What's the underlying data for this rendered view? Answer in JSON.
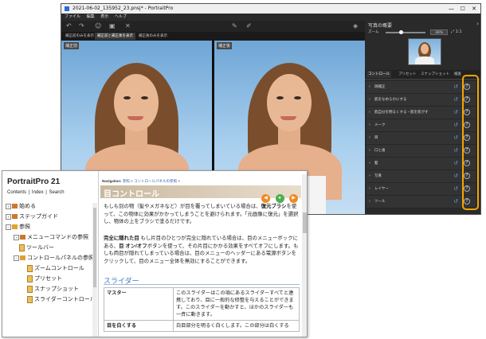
{
  "app_window": {
    "title": "2021-06-02_135952_23.pnsj* - PortraitPro",
    "controls": [
      "—",
      "☐",
      "✕"
    ],
    "menu": [
      "ファイル",
      "編集",
      "表示",
      "ヘルプ"
    ],
    "view_tabs": [
      "補正前のみを表示",
      "補正前と補正後を表示",
      "補正後のみを表示"
    ],
    "active_view_tab": 1,
    "photo_label_left": "補正前",
    "photo_label_right": "補正後",
    "right_panel": {
      "title": "写真の概要",
      "zoom_label": "ズーム",
      "zoom_value": "38%",
      "zoom_level": 0.38,
      "tabs": [
        "コントロール",
        "プリセット",
        "スナップショット",
        "検査"
      ],
      "active_tab": 0,
      "sections": [
        "顔補正",
        "肌をなめらかにする",
        "肌自分を明るくする・肌を焦がす",
        "メーク",
        "目",
        "口と歯",
        "髪",
        "写真",
        "レイヤー",
        "ツール"
      ]
    }
  },
  "help_window": {
    "app_name": "PortraitPro 21",
    "nav_links": [
      "Contents",
      "|",
      "Index",
      "|",
      "Search"
    ],
    "tree": [
      {
        "label": "始める",
        "indent": 0,
        "kind": "book-closed",
        "toggle": "+"
      },
      {
        "label": "ステップガイド",
        "indent": 0,
        "kind": "book-closed",
        "toggle": "+"
      },
      {
        "label": "参照",
        "indent": 0,
        "kind": "book-open",
        "toggle": "−"
      },
      {
        "label": "メニューコマンドの参照",
        "indent": 1,
        "kind": "book-closed",
        "toggle": "+"
      },
      {
        "label": "ツールバー",
        "indent": 1,
        "kind": "page",
        "toggle": ""
      },
      {
        "label": "コントロールパネルの参照",
        "indent": 1,
        "kind": "book-open",
        "toggle": "−"
      },
      {
        "label": "ズームコントロール",
        "indent": 2,
        "kind": "page",
        "toggle": ""
      },
      {
        "label": "プリセット",
        "indent": 2,
        "kind": "page",
        "toggle": ""
      },
      {
        "label": "スナップショット",
        "indent": 2,
        "kind": "page",
        "toggle": ""
      },
      {
        "label": "スライダーコントロール",
        "indent": 2,
        "kind": "page",
        "toggle": ""
      }
    ],
    "breadcrumb": {
      "prefix": "Navigation:",
      "items": [
        "参照",
        ">",
        "コントロールパネルの参照",
        ">"
      ]
    },
    "page_title": "目コントロール",
    "para1": {
      "pre": "もしも別の物（髪やメガネなど）が目を覆ってしまいている場合は、",
      "bold": "復元ブラシ",
      "post": "を使って、この物体に効果がかかってしまうことを避けられます。「元画像に復元」を選択し、物体の上をブラシで塗るだけです。"
    },
    "para2": {
      "bold1": "完全に隠れた目",
      "mid1": " もし片目のひとつが完全に隠れている場合は、目のメニューボックにある、",
      "bold2": "目 オン/オフ",
      "rest": "ボタンを使って、その片目にかかる効果をすべてオフにします。もしも両目が隠れてしまっている場合は、目のメニューのヘッダーにある電源ボタンをクリックして、目のメニュー全体を無効にすることができます。"
    },
    "section_title": "スライダー",
    "table": [
      {
        "key": "マスター",
        "value": "このスライダーはこの項にあるスライダーすべてと連携しており、目に一般的な修整を与えることができます。このスライダーを動かすと、ほかのスライダーも一斉に動きます。"
      },
      {
        "key": "目を白くする",
        "value": "白目部分を明るく白くします。この部分は白くする"
      }
    ]
  }
}
